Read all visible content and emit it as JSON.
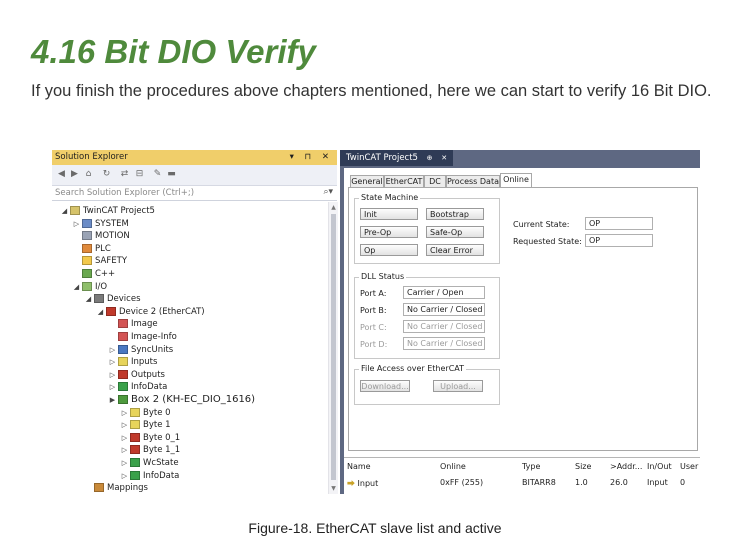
{
  "doc": {
    "heading": "4.16 Bit DIO Verify",
    "intro": "If you finish the procedures above chapters mentioned, here we can start to verify 16 Bit DIO.",
    "caption": "Figure-18. EtherCAT slave list and active"
  },
  "solution_explorer": {
    "title": "Solution Explorer",
    "title_controls": "▾ ⊓ ✕",
    "search_placeholder": "Search Solution Explorer (Ctrl+;)",
    "search_icon": "search-icon",
    "tree": [
      {
        "label": "TwinCAT Project5",
        "arrow": "◢",
        "icon_color": "#d6c36a"
      },
      {
        "label": "SYSTEM",
        "arrow": "▷",
        "icon_color": "#6b8cc7"
      },
      {
        "label": "MOTION",
        "arrow": "",
        "icon_color": "#9aa3b5"
      },
      {
        "label": "PLC",
        "arrow": "",
        "icon_color": "#e08a3c"
      },
      {
        "label": "SAFETY",
        "arrow": "",
        "icon_color": "#f2c94c"
      },
      {
        "label": "C++",
        "arrow": "",
        "icon_color": "#6aa84f"
      },
      {
        "label": "I/O",
        "arrow": "◢",
        "icon_color": "#8fbf6b"
      },
      {
        "label": "Devices",
        "arrow": "◢",
        "icon_color": "#7a7a7a"
      },
      {
        "label": "Device 2 (EtherCAT)",
        "arrow": "◢",
        "icon_color": "#c0392b"
      },
      {
        "label": "Image",
        "arrow": "",
        "icon_color": "#d35454"
      },
      {
        "label": "Image-Info",
        "arrow": "",
        "icon_color": "#d35454"
      },
      {
        "label": "SyncUnits",
        "arrow": "▷",
        "icon_color": "#4a78c2"
      },
      {
        "label": "Inputs",
        "arrow": "▷",
        "icon_color": "#e7d45b"
      },
      {
        "label": "Outputs",
        "arrow": "▷",
        "icon_color": "#c0392b"
      },
      {
        "label": "InfoData",
        "arrow": "▷",
        "icon_color": "#3aa14a"
      },
      {
        "label": "Box 2 (KH-EC_DIO_1616)",
        "arrow": "▶",
        "icon_color": "#4e9a3e"
      },
      {
        "label": "Byte 0",
        "arrow": "▷",
        "icon_color": "#e7d45b"
      },
      {
        "label": "Byte 1",
        "arrow": "▷",
        "icon_color": "#e7d45b"
      },
      {
        "label": "Byte 0_1",
        "arrow": "▷",
        "icon_color": "#c0392b"
      },
      {
        "label": "Byte 1_1",
        "arrow": "▷",
        "icon_color": "#c0392b"
      },
      {
        "label": "WcState",
        "arrow": "▷",
        "icon_color": "#3aa14a"
      },
      {
        "label": "InfoData",
        "arrow": "▷",
        "icon_color": "#3aa14a"
      },
      {
        "label": "Mappings",
        "arrow": "",
        "icon_color": "#c98a3a"
      }
    ]
  },
  "twincat": {
    "doc_tab": "TwinCAT Project5",
    "doc_tab_pin": "⊕",
    "doc_tab_close": "✕",
    "tabs": [
      "General",
      "EtherCAT",
      "DC",
      "Process Data",
      "Online"
    ],
    "state_machine": {
      "title": "State Machine",
      "buttons": [
        "Init",
        "Bootstrap",
        "Pre-Op",
        "Safe-Op",
        "Op",
        "Clear Error"
      ],
      "current_state_label": "Current State:",
      "current_state": "OP",
      "requested_state_label": "Requested State:",
      "requested_state": "OP"
    },
    "dll_status": {
      "title": "DLL Status",
      "ports": [
        {
          "label": "Port A:",
          "value": "Carrier / Open",
          "enabled": true
        },
        {
          "label": "Port B:",
          "value": "No Carrier / Closed",
          "enabled": true
        },
        {
          "label": "Port C:",
          "value": "No Carrier / Closed",
          "enabled": false
        },
        {
          "label": "Port D:",
          "value": "No Carrier / Closed",
          "enabled": false
        }
      ]
    },
    "file_access": {
      "title": "File Access over EtherCAT",
      "download": "Download...",
      "upload": "Upload..."
    },
    "online_list": {
      "headers": [
        "Name",
        "Online",
        "Type",
        "Size",
        ">Addr...",
        "In/Out",
        "User"
      ],
      "row": [
        "Input",
        "0xFF (255)",
        "BITARR8",
        "1.0",
        "26.0",
        "Input",
        "0"
      ]
    }
  }
}
